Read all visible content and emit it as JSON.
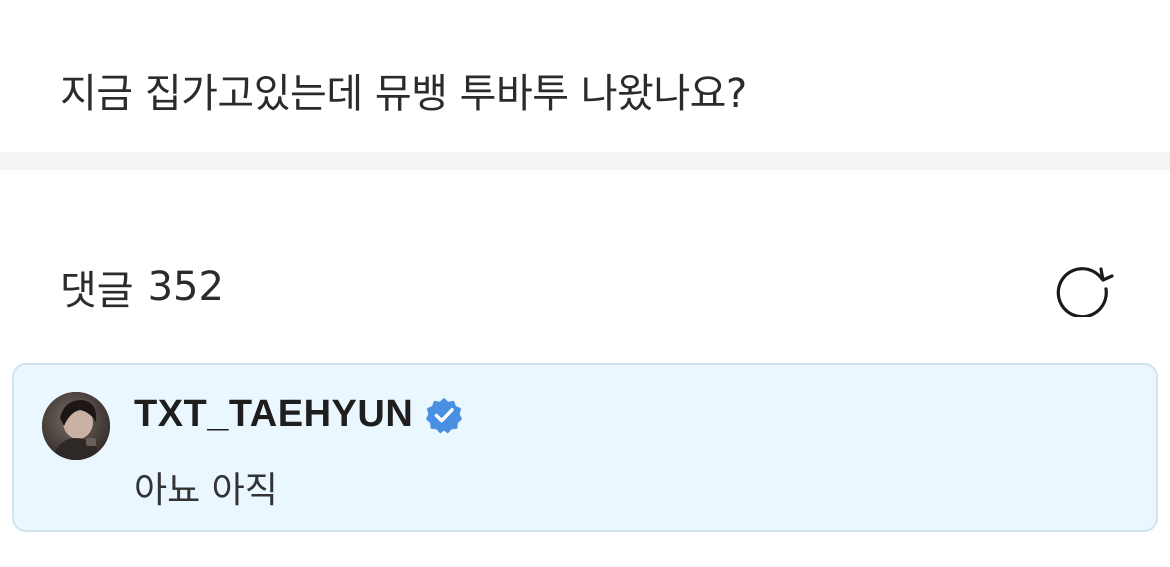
{
  "post": {
    "text": "지금 집가고있는데 뮤뱅 투바투 나왔나요?"
  },
  "comments": {
    "label": "댓글",
    "count": "352",
    "refresh_icon": "refresh-icon"
  },
  "comment": {
    "username": "TXT_TAEHYUN",
    "verified_icon": "verified-badge-icon",
    "text": "아뇨 아직",
    "verified_color": "#4a90e2",
    "card_background": "#ebf7fe"
  }
}
